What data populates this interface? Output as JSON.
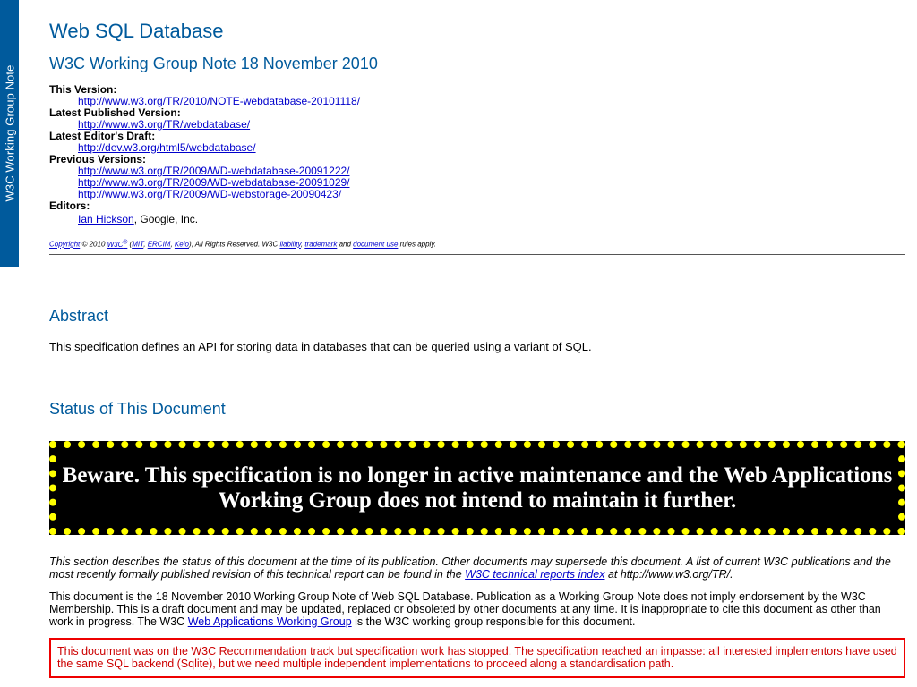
{
  "logo": {
    "text": "W3C Working Group Note"
  },
  "header": {
    "title": "Web SQL Database",
    "subtitle": "W3C Working Group Note 18 November 2010"
  },
  "meta": {
    "this_version_label": "This Version:",
    "this_version_link": "http://www.w3.org/TR/2010/NOTE-webdatabase-20101118/",
    "latest_published_label": "Latest Published Version:",
    "latest_published_link": "http://www.w3.org/TR/webdatabase/",
    "latest_editor_label": "Latest Editor's Draft:",
    "latest_editor_link": "http://dev.w3.org/html5/webdatabase/",
    "previous_label": "Previous Versions:",
    "previous_links": [
      "http://www.w3.org/TR/2009/WD-webdatabase-20091222/",
      "http://www.w3.org/TR/2009/WD-webdatabase-20091029/",
      "http://www.w3.org/TR/2009/WD-webstorage-20090423/"
    ],
    "editors_label": "Editors:",
    "editor_name": "Ian Hickson",
    "editor_affil": ", Google, Inc."
  },
  "copyright": {
    "link1": "Copyright",
    "text1": " © 2010 ",
    "w3c": "W3C",
    "reg": "®",
    "text2": " (",
    "mit": "MIT",
    "ercim": "ERCIM",
    "keio": "Keio",
    "text3": "), All Rights Reserved. W3C ",
    "liability": "liability",
    "trademark": "trademark",
    "and": " and ",
    "document_use": "document use",
    "tail": " rules apply."
  },
  "abstract": {
    "heading": "Abstract",
    "text": "This specification defines an API for storing data in databases that can be queried using a variant of SQL."
  },
  "status": {
    "heading": "Status of This Document",
    "beware": "Beware. This specification is no longer in active maintenance and the Web Applications Working Group does not intend to maintain it further.",
    "intro_part1": "This section describes the status of this document at the time of its publication. Other documents may supersede this document. A list of current W3C publications and the most recently formally published revision of this technical report can be found in the ",
    "intro_link": "W3C technical reports index",
    "intro_part2": " at http://www.w3.org/TR/.",
    "body_part1": "This document is the 18 November 2010 Working Group Note of Web SQL Database. Publication as a Working Group Note does not imply endorsement by the W3C Membership. This is a draft document and may be updated, replaced or obsoleted by other documents at any time. It is inappropriate to cite this document as other than work in progress. The W3C ",
    "body_link": "Web Applications Working Group",
    "body_part2": " is the W3C working group responsible for this document.",
    "red_notice": "This document was on the W3C Recommendation track but specification work has stopped. The specification reached an impasse: all interested implementors have used the same SQL backend (Sqlite), but we need multiple independent implementations to proceed along a standardisation path."
  },
  "colors": {
    "heading": "#005a9c",
    "logo_bg": "#005a9c",
    "beware_bg": "#000000",
    "beware_dots": "#ffff00",
    "red_notice": "#cc0000"
  }
}
